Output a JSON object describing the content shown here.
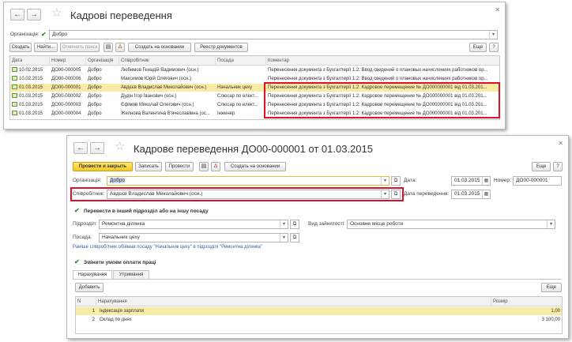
{
  "list_window": {
    "title": "Кадрові переведення",
    "org_label": "Організація:",
    "org_value": "Добро",
    "toolbar": {
      "create": "Создать",
      "find": "Найти...",
      "cancel_search": "Отменить поиск",
      "create_based": "Создать на основании",
      "registry": "Реестр документов",
      "more": "Еще",
      "help": "?"
    },
    "columns": [
      "Дата",
      "Номер",
      "Організація",
      "Співробітник",
      "Посада",
      "Коментар"
    ],
    "rows": [
      {
        "date": "10.02.2015",
        "num": "ДО00-000005",
        "org": "Добро",
        "emp": "Любимов Генадій Вадимович (осн.)",
        "pos": "",
        "comment": "Перенесення документа з Бухгалтерії 1.2: Ввод сведений о плановых начислениях работников ор..."
      },
      {
        "date": "10.02.2015",
        "num": "ДО00-000006",
        "org": "Добро",
        "emp": "Максимов Юрій Олегович (осн.)",
        "pos": "",
        "comment": "Перенесення документа з Бухгалтерії 1.2: Ввод сведений о плановых начислениях работников ор..."
      },
      {
        "date": "01.03.2015",
        "num": "ДО00-000001",
        "org": "Добро",
        "emp": "Авдєєв Владислав Миколайович (осн.)",
        "pos": "Начальник цеху",
        "comment": "Перенесення документа з Бухгалтерії 1.2: Кадровое перемещение № ДО000000001 від 01.03.201..."
      },
      {
        "date": "01.03.2015",
        "num": "ДО00-000002",
        "org": "Добро",
        "emp": "Дудін Ігор Іванович (осн.)",
        "pos": "Слюсар по елект...",
        "comment": "Перенесення документа з Бухгалтерії 1.2: Кадровое перемещение № ДО000000001 від 01.03.201..."
      },
      {
        "date": "01.03.2015",
        "num": "ДО00-000003",
        "org": "Добро",
        "emp": "Єфімов Миколай Олегович (осн.)",
        "pos": "Слюсар по елект...",
        "comment": "Перенесення документа з Бухгалтерії 1.2: Кадровое перемещение № ДО000000001 від 01.03.201..."
      },
      {
        "date": "01.03.2015",
        "num": "ДО00-000004",
        "org": "Добро",
        "emp": "Желнова Валентина В'ячеславівна (ос...",
        "pos": "Інженер",
        "comment": "Перенесення документа з Бухгалтерії 1.2: Кадровое перемещение № ДО000000001 від 01.03.201..."
      }
    ]
  },
  "form_window": {
    "title": "Кадрове переведення ДО00-000001 от 01.03.2015",
    "toolbar": {
      "post_close": "Провести и закрыть",
      "save": "Записать",
      "post": "Провести",
      "create_based": "Создать на основании",
      "more": "Еще",
      "help": "?"
    },
    "org_label": "Організація:",
    "org_value": "Добро",
    "date_label": "Дата:",
    "date_value": "01.03.2015",
    "number_label": "Номер:",
    "number_value": "ДО00-000001",
    "emp_label": "Співробітник:",
    "emp_value": "Авдєєв Владислав Миколайович (осн.)",
    "transfer_date_label": "Дата переведення:",
    "transfer_date_value": "01.03.2015",
    "transfer_check_label": "Перевести в інший підрозділ або на іншу посаду",
    "dept_label": "Підрозділ:",
    "dept_value": "Ремонтна ділянка",
    "employment_label": "Вид зайнятості:",
    "employment_value": "Основне місце роботи",
    "position_label": "Посада:",
    "position_value": "Начальник цеху",
    "info_text": "Раніше співробітник обіймав посаду \"Начальник цеху\" в підрозділі \"Ремонтна ділянка\"",
    "pay_check_label": "Змінити умови оплати праці",
    "tabs": [
      "Нарахування",
      "Утримання"
    ],
    "add_button": "Добавить",
    "more2": "Еще",
    "grid_columns": [
      "N",
      "Нарахування",
      "Розмір"
    ],
    "grid_rows": [
      {
        "n": "1",
        "name": "Індексація зарплати",
        "size": "1,00"
      },
      {
        "n": "2",
        "name": "Оклад по днях",
        "size": "3 100,00"
      }
    ]
  }
}
